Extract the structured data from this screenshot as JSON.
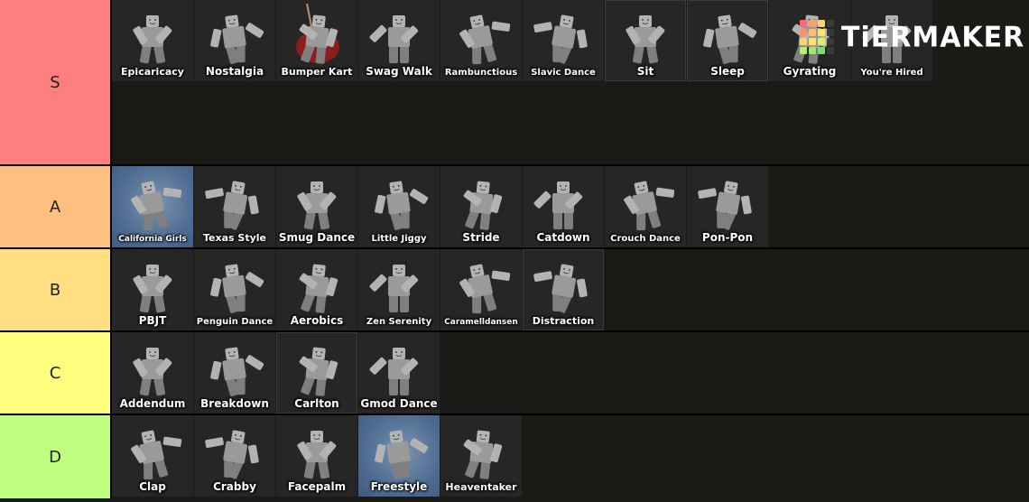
{
  "logo": {
    "text": "TiERMAKER",
    "grid_colors": [
      "#ff6b6b",
      "#ff9f6b",
      "#ffd36b",
      "#3a3a3a",
      "#ff8f6b",
      "#ffbf6b",
      "#ffe66b",
      "#3a3a3a",
      "#ffd36b",
      "#ffe66b",
      "#d9f06b",
      "#3a3a3a",
      "#b8f06b",
      "#9ee86b",
      "#7be06b",
      "#3a3a3a"
    ]
  },
  "tiers": [
    {
      "label": "S",
      "color": "#ff7f7f",
      "items": [
        {
          "caption": "Epicaricacy",
          "style": ""
        },
        {
          "caption": "Nostalgia",
          "style": ""
        },
        {
          "caption": "Bumper Kart",
          "style": "kart"
        },
        {
          "caption": "Swag Walk",
          "style": ""
        },
        {
          "caption": "Rambunctious",
          "style": ""
        },
        {
          "caption": "Slavic Dance",
          "style": ""
        },
        {
          "caption": "Sit",
          "style": "bordered"
        },
        {
          "caption": "Sleep",
          "style": "bordered"
        },
        {
          "caption": "Gyrating",
          "style": ""
        },
        {
          "caption": "You're Hired",
          "style": ""
        }
      ]
    },
    {
      "label": "A",
      "color": "#ffbf7f",
      "items": [
        {
          "caption": "California Girls",
          "style": "blue"
        },
        {
          "caption": "Texas Style",
          "style": ""
        },
        {
          "caption": "Smug Dance",
          "style": ""
        },
        {
          "caption": "Little Jiggy",
          "style": ""
        },
        {
          "caption": "Stride",
          "style": ""
        },
        {
          "caption": "Catdown",
          "style": ""
        },
        {
          "caption": "Crouch Dance",
          "style": ""
        },
        {
          "caption": "Pon-Pon",
          "style": ""
        }
      ]
    },
    {
      "label": "B",
      "color": "#ffdf7f",
      "items": [
        {
          "caption": "PBJT",
          "style": ""
        },
        {
          "caption": "Penguin Dance",
          "style": ""
        },
        {
          "caption": "Aerobics",
          "style": ""
        },
        {
          "caption": "Zen Serenity",
          "style": ""
        },
        {
          "caption": "Caramelldansen",
          "style": ""
        },
        {
          "caption": "Distraction",
          "style": "bordered"
        }
      ]
    },
    {
      "label": "C",
      "color": "#ffff7f",
      "items": [
        {
          "caption": "Addendum",
          "style": ""
        },
        {
          "caption": "Breakdown",
          "style": ""
        },
        {
          "caption": "Carlton",
          "style": "bordered"
        },
        {
          "caption": "Gmod Dance",
          "style": ""
        }
      ]
    },
    {
      "label": "D",
      "color": "#bfff7f",
      "items": [
        {
          "caption": "Clap",
          "style": ""
        },
        {
          "caption": "Crabby",
          "style": ""
        },
        {
          "caption": "Facepalm",
          "style": ""
        },
        {
          "caption": "Freestyle",
          "style": "blue"
        },
        {
          "caption": "Heaventaker",
          "style": ""
        }
      ]
    }
  ]
}
